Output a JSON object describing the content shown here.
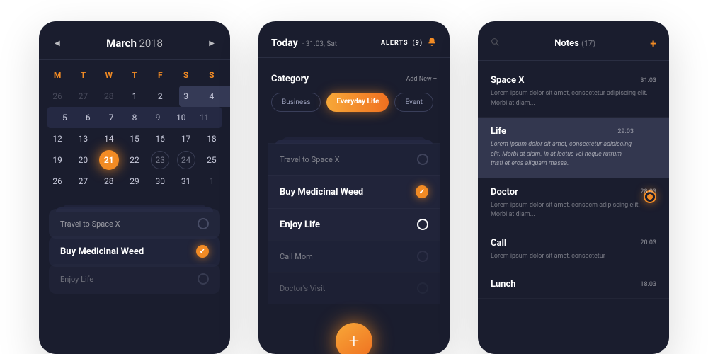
{
  "calendar": {
    "month": "March",
    "year": "2018",
    "dow": [
      "M",
      "T",
      "W",
      "T",
      "F",
      "S",
      "S"
    ],
    "weeks": [
      [
        {
          "n": "26"
        },
        {
          "n": "27"
        },
        {
          "n": "28"
        },
        {
          "n": "1"
        },
        {
          "n": "2"
        },
        {
          "n": "3"
        },
        {
          "n": "4"
        }
      ],
      [
        {
          "n": "5"
        },
        {
          "n": "6"
        },
        {
          "n": "7"
        },
        {
          "n": "8"
        },
        {
          "n": "9"
        },
        {
          "n": "10"
        },
        {
          "n": "11"
        }
      ],
      [
        {
          "n": "12"
        },
        {
          "n": "13"
        },
        {
          "n": "14"
        },
        {
          "n": "15"
        },
        {
          "n": "16"
        },
        {
          "n": "17"
        },
        {
          "n": "18"
        }
      ],
      [
        {
          "n": "19"
        },
        {
          "n": "20"
        },
        {
          "n": "21"
        },
        {
          "n": "22"
        },
        {
          "n": "23"
        },
        {
          "n": "24"
        },
        {
          "n": "25"
        }
      ],
      [
        {
          "n": "26"
        },
        {
          "n": "27"
        },
        {
          "n": "28"
        },
        {
          "n": "29"
        },
        {
          "n": "30"
        },
        {
          "n": "31"
        },
        {
          "n": "1"
        }
      ]
    ],
    "selected_day": "21",
    "tasks": [
      {
        "label": "Travel to Space X",
        "done": false
      },
      {
        "label": "Buy Medicinal Weed",
        "done": true
      },
      {
        "label": "Enjoy Life",
        "done": false
      }
    ]
  },
  "today": {
    "title": "Today",
    "subtitle": "· 31.03, Sat",
    "alerts_label": "ALERTS",
    "alerts_count": "(9)",
    "category_label": "Category",
    "add_new": "Add New  +",
    "chips": [
      "Business",
      "Everyday Life",
      "Event"
    ],
    "active_chip": "Everyday Life",
    "tasks": [
      {
        "label": "Travel to Space X",
        "state": "dim"
      },
      {
        "label": "Buy Medicinal Weed",
        "state": "done"
      },
      {
        "label": "Enjoy Life",
        "state": "bold"
      },
      {
        "label": "Call Mom",
        "state": "dim"
      },
      {
        "label": "Doctor's Visit",
        "state": "dim"
      }
    ]
  },
  "notes": {
    "title": "Notes",
    "count": "(17)",
    "items": [
      {
        "title": "Space X",
        "date": "31.03",
        "body": "Lorem ipsum dolor sit amet, consectetur adipiscing elit. Morbi at diam..."
      },
      {
        "title": "Life",
        "date": "29.03",
        "body": "Lorem ipsum dolor sit amet, consectetur adipiscing elit. Morbi at diam. In at lectus vel neque rutrum tristi et eros aliquam massa.",
        "hl": true
      },
      {
        "title": "Doctor",
        "date": "28.03",
        "body": "Lorem ipsum dolor sit amet, consecm adipiscing elit. Morbi at diam..."
      },
      {
        "title": "Call",
        "date": "20.03",
        "body": "Lorem ipsum dolor sit amet, consectetur"
      },
      {
        "title": "Lunch",
        "date": "18.03",
        "body": ""
      }
    ]
  }
}
